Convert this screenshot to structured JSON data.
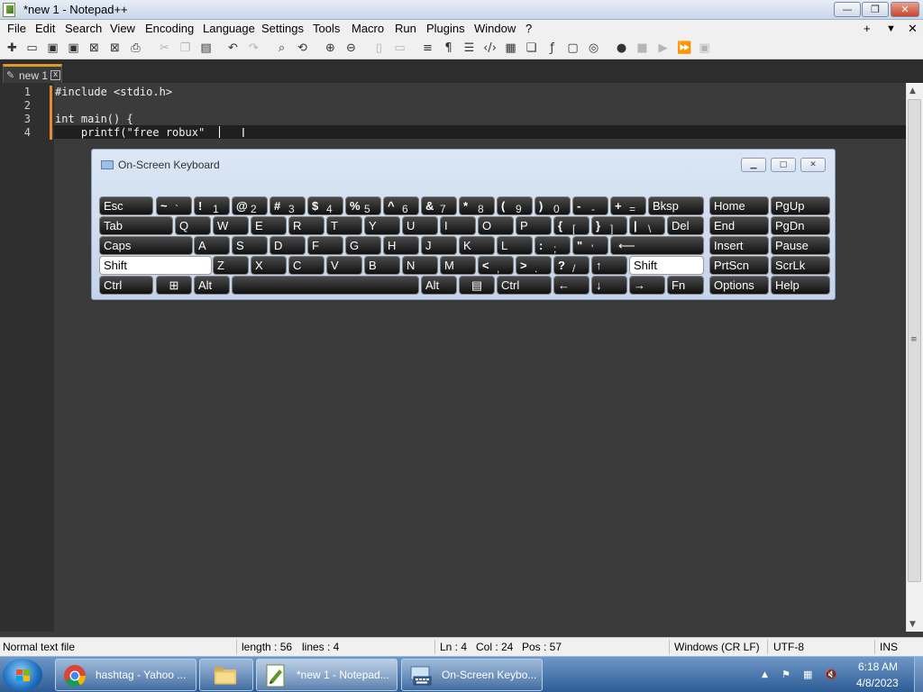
{
  "window": {
    "title": "*new 1 - Notepad++",
    "min": "—",
    "max": "❐",
    "close": "✕"
  },
  "menu": {
    "items": [
      "File",
      "Edit",
      "Search",
      "View",
      "Encoding",
      "Language",
      "Settings",
      "Tools",
      "Macro",
      "Run",
      "Plugins",
      "Window",
      "?"
    ],
    "right": {
      "plus": "+",
      "down": "▼",
      "close": "✕"
    }
  },
  "tab": {
    "label": "new 1",
    "close": "x"
  },
  "editor": {
    "lines": [
      "#include <stdio.h>",
      "",
      "int main() {",
      "    printf(\"free robux\""
    ],
    "line_numbers": [
      "1",
      "2",
      "3",
      "4"
    ]
  },
  "osk": {
    "title": "On-Screen Keyboard",
    "row1": [
      {
        "t": "Esc"
      },
      {
        "t": "~",
        "s": "`"
      },
      {
        "t": "!",
        "s": "1"
      },
      {
        "t": "@",
        "s": "2"
      },
      {
        "t": "#",
        "s": "3"
      },
      {
        "t": "$",
        "s": "4"
      },
      {
        "t": "%",
        "s": "5"
      },
      {
        "t": "^",
        "s": "6"
      },
      {
        "t": "&",
        "s": "7"
      },
      {
        "t": "*",
        "s": "8"
      },
      {
        "t": "(",
        "s": "9"
      },
      {
        "t": ")",
        "s": "0"
      },
      {
        "t": "-",
        "s": "-"
      },
      {
        "t": "+",
        "s": "="
      },
      {
        "t": "Bksp"
      },
      {
        "t": "Home"
      },
      {
        "t": "PgUp"
      }
    ],
    "row2": [
      {
        "t": "Tab"
      },
      {
        "t": "Q"
      },
      {
        "t": "W"
      },
      {
        "t": "E"
      },
      {
        "t": "R"
      },
      {
        "t": "T"
      },
      {
        "t": "Y"
      },
      {
        "t": "U"
      },
      {
        "t": "I"
      },
      {
        "t": "O"
      },
      {
        "t": "P"
      },
      {
        "t": "{",
        "s": "["
      },
      {
        "t": "}",
        "s": "]"
      },
      {
        "t": "|",
        "s": "\\"
      },
      {
        "t": "Del"
      },
      {
        "t": "End"
      },
      {
        "t": "PgDn"
      }
    ],
    "row3": [
      {
        "t": "Caps"
      },
      {
        "t": "A"
      },
      {
        "t": "S"
      },
      {
        "t": "D"
      },
      {
        "t": "F"
      },
      {
        "t": "G"
      },
      {
        "t": "H"
      },
      {
        "t": "J"
      },
      {
        "t": "K"
      },
      {
        "t": "L"
      },
      {
        "t": ":",
        "s": ";"
      },
      {
        "t": "\"",
        "s": "'"
      },
      {
        "t": "⟵"
      },
      {
        "t": "Insert"
      },
      {
        "t": "Pause"
      }
    ],
    "row4": [
      {
        "t": "Shift"
      },
      {
        "t": "Z"
      },
      {
        "t": "X"
      },
      {
        "t": "C"
      },
      {
        "t": "V"
      },
      {
        "t": "B"
      },
      {
        "t": "N"
      },
      {
        "t": "M"
      },
      {
        "t": "<",
        "s": ","
      },
      {
        "t": ">",
        "s": "."
      },
      {
        "t": "?",
        "s": "/"
      },
      {
        "t": "↑"
      },
      {
        "t": "Shift"
      },
      {
        "t": "PrtScn"
      },
      {
        "t": "ScrLk"
      }
    ],
    "row5": [
      {
        "t": "Ctrl"
      },
      {
        "t": "⊞"
      },
      {
        "t": "Alt"
      },
      {
        "t": ""
      },
      {
        "t": "Alt"
      },
      {
        "t": "▤"
      },
      {
        "t": "Ctrl"
      },
      {
        "t": "←"
      },
      {
        "t": "↓"
      },
      {
        "t": "→"
      },
      {
        "t": "Fn"
      },
      {
        "t": "Options"
      },
      {
        "t": "Help"
      }
    ]
  },
  "status": {
    "type": "Normal text file",
    "length": "length : 56",
    "lines": "lines : 4",
    "ln": "Ln : 4",
    "col": "Col : 24",
    "pos": "Pos : 57",
    "eol": "Windows (CR LF)",
    "encoding": "UTF-8",
    "mode": "INS"
  },
  "taskbar": {
    "items": [
      "hashtag - Yahoo ...",
      "*new 1 - Notepad...",
      "On-Screen Keybo..."
    ],
    "time": "6:18 AM",
    "date": "4/8/2023"
  }
}
